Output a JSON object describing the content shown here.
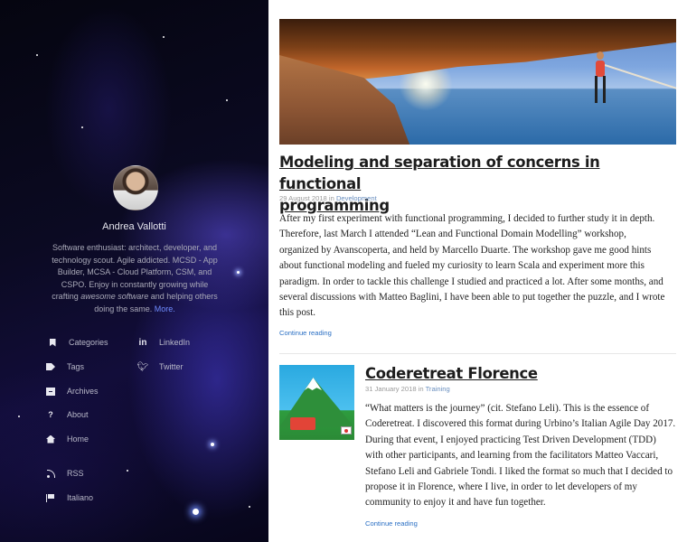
{
  "author": {
    "name": "Andrea Vallotti",
    "bio_part1": "Software enthusiast: architect, developer, and technology scout. Agile addicted. MCSD - App Builder, MCSA - Cloud Platform, CSM, and CSPO. Enjoy in constantly growing while crafting ",
    "bio_emphasis": "awesome software",
    "bio_part2": " and helping others doing the same. ",
    "bio_more_link": "More."
  },
  "nav": {
    "left": [
      {
        "label": "Categories",
        "icon": "bookmark-icon"
      },
      {
        "label": "Tags",
        "icon": "tags-icon"
      },
      {
        "label": "Archives",
        "icon": "archive-icon"
      },
      {
        "label": "About",
        "icon": "question-icon"
      },
      {
        "label": "Home",
        "icon": "home-icon"
      }
    ],
    "right": [
      {
        "label": "LinkedIn",
        "icon": "linkedin-icon"
      },
      {
        "label": "Twitter",
        "icon": "twitter-icon"
      }
    ],
    "bottom": [
      {
        "label": "RSS",
        "icon": "rss-icon"
      },
      {
        "label": "Italiano",
        "icon": "flag-icon"
      }
    ]
  },
  "posts": [
    {
      "title_line1": "Modeling and separation of concerns in functional",
      "title_line2": "programming",
      "date": "29 August 2018",
      "in": " in ",
      "category": "Development",
      "excerpt_lines": [
        "After my first experiment with functional programming, I decided to further study it in depth.",
        "Therefore, last March I attended “Lean and Functional Domain Modelling” workshop,",
        "organized by Avanscoperta, and held by Marcello Duarte. The workshop gave me good hints",
        "about functional modeling and fueled my curiosity to learn Scala and experiment more this",
        "paradigm. In order to tackle this challenge I studied and practiced a lot. After some months, and",
        "several discussions with Matteo Baglini, I have been able to put together the puzzle, and I wrote",
        "this post."
      ],
      "continue": "Continue reading"
    },
    {
      "title": "Coderetreat Florence",
      "date": "31 January 2018",
      "in": " in ",
      "category": "Training",
      "excerpt_lines": [
        "“What matters is the journey” (cit. Stefano Leli). This is the essence of",
        "Coderetreat. I discovered this format during Urbino’s Italian Agile Day 2017.",
        "During that event, I enjoyed practicing Test Driven Development (TDD)",
        "with other participants, and learning from the facilitators Matteo Vaccari,",
        "Stefano Leli and Gabriele Tondi. I liked the format so much that I decided to",
        "propose it in Florence, where I live, in order to let developers of my",
        "community to enjoy it and have fun together."
      ],
      "continue": "Continue reading"
    }
  ]
}
